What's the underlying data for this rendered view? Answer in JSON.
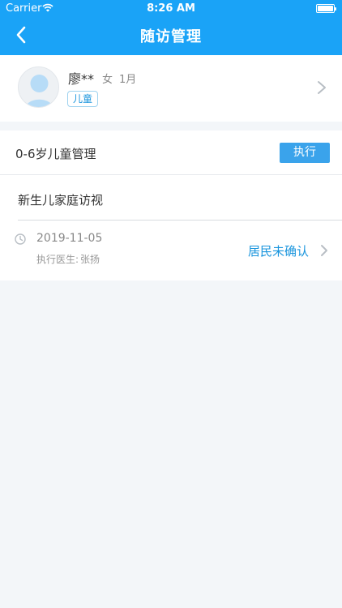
{
  "status_bar": {
    "carrier": "Carrier",
    "time": "8:26 AM"
  },
  "nav": {
    "title": "随访管理",
    "back_icon": "chevron-left-icon"
  },
  "patient": {
    "name": "廖**",
    "gender": "女",
    "age": "1月",
    "tag": "儿童",
    "avatar_icon": "child-avatar-icon"
  },
  "program": {
    "title": "0-6岁儿童管理",
    "execute_label": "执行",
    "visit": {
      "title": "新生儿家庭访视",
      "date": "2019-11-05",
      "doctor_label": "执行医生:",
      "doctor_name": "张扬",
      "status": "居民未确认"
    }
  },
  "colors": {
    "header": "#1aa3f7",
    "accent": "#1a95dd",
    "button": "#3aa3eb",
    "background": "#f3f6f9"
  }
}
